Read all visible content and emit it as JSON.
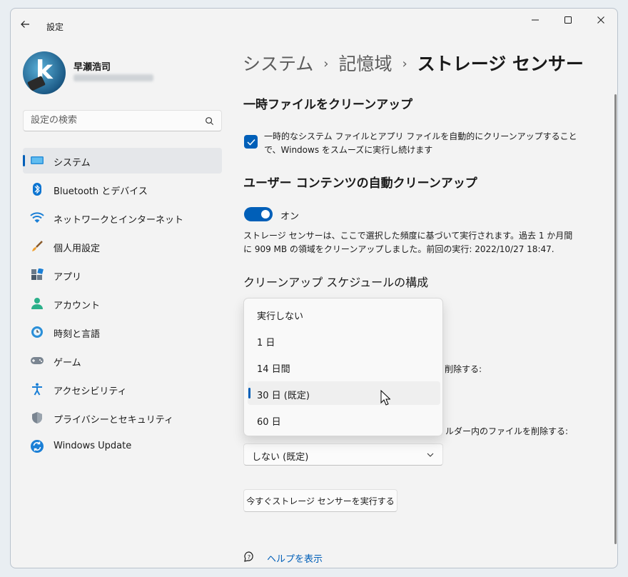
{
  "window": {
    "title": "設定"
  },
  "user": {
    "name": "早瀬浩司"
  },
  "search": {
    "placeholder": "設定の検索"
  },
  "nav": [
    {
      "label": "システム",
      "icon": "system-icon",
      "active": true
    },
    {
      "label": "Bluetooth とデバイス",
      "icon": "bluetooth-icon"
    },
    {
      "label": "ネットワークとインターネット",
      "icon": "wifi-icon"
    },
    {
      "label": "個人用設定",
      "icon": "brush-icon"
    },
    {
      "label": "アプリ",
      "icon": "apps-icon"
    },
    {
      "label": "アカウント",
      "icon": "account-icon"
    },
    {
      "label": "時刻と言語",
      "icon": "time-language-icon"
    },
    {
      "label": "ゲーム",
      "icon": "gamepad-icon"
    },
    {
      "label": "アクセシビリティ",
      "icon": "accessibility-icon"
    },
    {
      "label": "プライバシーとセキュリティ",
      "icon": "shield-icon"
    },
    {
      "label": "Windows Update",
      "icon": "windows-update-icon"
    }
  ],
  "breadcrumb": {
    "item1": "システム",
    "item2": "記憶域",
    "current": "ストレージ センサー",
    "separator": "›"
  },
  "temp_cleanup": {
    "title": "一時ファイルをクリーンアップ",
    "checkbox_text": "一時的なシステム ファイルとアプリ ファイルを自動的にクリーンアップすることで、Windows をスムーズに実行し続けます",
    "checked": true
  },
  "auto_cleanup": {
    "title": "ユーザー コンテンツの自動クリーンアップ",
    "toggle_label": "オン",
    "toggle_on": true,
    "description": "ストレージ センサーは、ここで選択した頻度に基づいて実行されます。過去 1 か月間に 909 MB の領域をクリーンアップしました。前回の実行: 2022/10/27 18:47."
  },
  "schedule": {
    "title": "クリーンアップ スケジュールの構成",
    "options": [
      "実行しない",
      "1 日",
      "14 日間",
      "30 日 (既定)",
      "60 日"
    ],
    "selected_index": 3
  },
  "partial_labels": {
    "recycle_bin_tail": "削除する:",
    "downloads_tail": "ルダー内のファイルを削除する:"
  },
  "downloads_combo": {
    "value": "しない (既定)"
  },
  "run_button": {
    "label": "今すぐストレージ センサーを実行する"
  },
  "help": {
    "label": "ヘルプを表示"
  },
  "colors": {
    "accent": "#005fb8",
    "background": "#f3f3f3"
  }
}
